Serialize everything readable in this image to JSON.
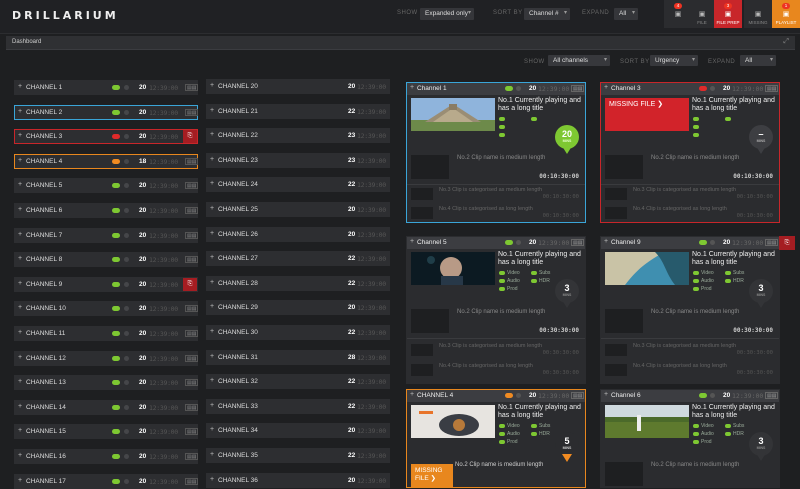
{
  "app": {
    "title": "DRILLARIUM"
  },
  "topbar": {
    "show_label": "SHOW",
    "show_value": "Expanded only",
    "sort_label": "SORT BY",
    "sort_value": "Channel #",
    "expand_label": "EXPAND",
    "expand_value": "All",
    "alerts_title": "ALERTS",
    "alerts": [
      {
        "label": "",
        "count": "4",
        "style": "default"
      },
      {
        "label": "FILE",
        "count": "",
        "style": "default"
      },
      {
        "label": "FILE PREP",
        "count": "3",
        "style": "red"
      },
      {
        "label": "MISSING",
        "count": "",
        "style": "default"
      },
      {
        "label": "PLAYLIST",
        "count": "1",
        "style": "orange"
      }
    ]
  },
  "dashboard": {
    "title": "Dashboard",
    "show_label": "SHOW",
    "show_value": "All channels",
    "sort_label": "SORT BY",
    "sort_value": "Urgency",
    "expand_label": "EXPAND",
    "expand_value": "All"
  },
  "channels_left": [
    {
      "name": "CHANNEL 1",
      "status": "green",
      "count": "20",
      "time": "12:39:00",
      "border": ""
    },
    {
      "name": "CHANNEL 2",
      "status": "green",
      "count": "20",
      "time": "12:39:00",
      "border": "blue"
    },
    {
      "name": "CHANNEL 3",
      "status": "red",
      "count": "20",
      "time": "12:39:00",
      "border": "red",
      "alert": true
    },
    {
      "name": "CHANNEL 4",
      "status": "orange",
      "count": "18",
      "time": "12:39:00",
      "border": "orange"
    },
    {
      "name": "CHANNEL 5",
      "status": "green",
      "count": "20",
      "time": "12:39:00",
      "border": ""
    },
    {
      "name": "CHANNEL 6",
      "status": "green",
      "count": "20",
      "time": "12:39:00",
      "border": ""
    },
    {
      "name": "CHANNEL 7",
      "status": "green",
      "count": "20",
      "time": "12:39:00",
      "border": ""
    },
    {
      "name": "CHANNEL 8",
      "status": "green",
      "count": "20",
      "time": "12:39:00",
      "border": ""
    },
    {
      "name": "CHANNEL 9",
      "status": "green",
      "count": "20",
      "time": "12:39:00",
      "border": "",
      "alert": true
    },
    {
      "name": "CHANNEL 10",
      "status": "green",
      "count": "20",
      "time": "12:39:00",
      "border": ""
    },
    {
      "name": "CHANNEL 11",
      "status": "green",
      "count": "20",
      "time": "12:39:00",
      "border": ""
    },
    {
      "name": "CHANNEL 12",
      "status": "green",
      "count": "20",
      "time": "12:39:00",
      "border": ""
    },
    {
      "name": "CHANNEL 13",
      "status": "green",
      "count": "20",
      "time": "12:39:00",
      "border": ""
    },
    {
      "name": "CHANNEL 14",
      "status": "green",
      "count": "20",
      "time": "12:39:00",
      "border": ""
    },
    {
      "name": "CHANNEL 15",
      "status": "green",
      "count": "20",
      "time": "12:39:00",
      "border": ""
    },
    {
      "name": "CHANNEL 16",
      "status": "green",
      "count": "20",
      "time": "12:39:00",
      "border": ""
    },
    {
      "name": "CHANNEL 17",
      "status": "green",
      "count": "20",
      "time": "12:39:00",
      "border": ""
    }
  ],
  "channels_right": [
    {
      "name": "CHANNEL 20",
      "count": "20",
      "time": "12:39:00"
    },
    {
      "name": "CHANNEL 21",
      "count": "22",
      "time": "12:39:00"
    },
    {
      "name": "CHANNEL 22",
      "count": "23",
      "time": "12:39:00"
    },
    {
      "name": "CHANNEL 23",
      "count": "23",
      "time": "12:39:00"
    },
    {
      "name": "CHANNEL 24",
      "count": "22",
      "time": "12:39:00"
    },
    {
      "name": "CHANNEL 25",
      "count": "20",
      "time": "12:39:00"
    },
    {
      "name": "CHANNEL 26",
      "count": "20",
      "time": "12:39:00"
    },
    {
      "name": "CHANNEL 27",
      "count": "22",
      "time": "12:39:00"
    },
    {
      "name": "CHANNEL 28",
      "count": "22",
      "time": "12:39:00"
    },
    {
      "name": "CHANNEL 29",
      "count": "20",
      "time": "12:39:00"
    },
    {
      "name": "CHANNEL 30",
      "count": "22",
      "time": "12:39:00"
    },
    {
      "name": "CHANNEL 31",
      "count": "28",
      "time": "12:39:00"
    },
    {
      "name": "CHANNEL 32",
      "count": "22",
      "time": "12:39:00"
    },
    {
      "name": "CHANNEL 33",
      "count": "22",
      "time": "12:39:00"
    },
    {
      "name": "CHANNEL 34",
      "count": "20",
      "time": "12:39:00"
    },
    {
      "name": "CHANNEL 35",
      "count": "22",
      "time": "12:39:00"
    },
    {
      "name": "CHANNEL 36",
      "count": "20",
      "time": "12:39:00"
    }
  ],
  "cards": [
    {
      "name": "Channel 1",
      "border": "blue",
      "status": "green",
      "count": "20",
      "time": "12:39:00",
      "now": "No.1 Currently playing and has a long title",
      "pin": "20",
      "pin_unit": "MINS",
      "pin_style": "green",
      "thumb": "pyramid",
      "clip2": "No.2 Clip name is medium length",
      "clip2_time": "00:10:30:00",
      "clip3": "No.3 Clip is categorised as medium length",
      "clip3_time": "00:10:30:00",
      "clip4": "No.4 Clip is categorised as long length",
      "clip4_time": "00:10:30:00",
      "stats": [
        "",
        "",
        "",
        ""
      ]
    },
    {
      "name": "Channel 3",
      "border": "red",
      "status": "red",
      "count": "20",
      "time": "12:39:00",
      "now": "No.1 Currently playing and has a long title",
      "pin": "–",
      "pin_unit": "MINS",
      "pin_style": "dark",
      "thumb": "missing",
      "missing": "MISSING FILE ❯",
      "clip2": "No.2 Clip name is medium length",
      "clip2_time": "00:10:30:00",
      "clip3": "No.3 Clip is categorised as medium length",
      "clip3_time": "00:10:30:00",
      "clip4": "No.4 Clip is categorised as long length",
      "clip4_time": "00:10:30:00",
      "stats": [
        "",
        "",
        "",
        ""
      ]
    },
    {
      "name": "Channel 5",
      "border": "",
      "status": "green",
      "count": "20",
      "time": "12:39:00",
      "now": "No.1 Currently playing and has a long title",
      "pin": "3",
      "pin_unit": "MINS",
      "pin_style": "dark2",
      "thumb": "face",
      "clip2": "No.2 Clip name is medium length",
      "clip2_time": "00:30:30:00",
      "clip3": "No.3 Clip is categorised as medium length",
      "clip3_time": "00:30:30:00",
      "clip4": "No.4 Clip is categorised as long length",
      "clip4_time": "00:30:30:00",
      "stats": [
        "Video",
        "Audio",
        "Prod",
        "Subs",
        "HDR"
      ]
    },
    {
      "name": "Channel 9",
      "border": "",
      "status": "green",
      "count": "20",
      "time": "12:39:00",
      "alert": true,
      "now": "No.1 Currently playing and has a long title",
      "pin": "3",
      "pin_unit": "MINS",
      "pin_style": "dark2",
      "thumb": "coast",
      "clip2": "No.2 Clip name is medium length",
      "clip2_time": "00:30:30:00",
      "clip3": "No.3 Clip is categorised as medium length",
      "clip3_time": "00:30:30:00",
      "clip4": "No.4 Clip is categorised as long length",
      "clip4_time": "00:30:30:00",
      "stats": [
        "Video",
        "Audio",
        "Prod",
        "Subs",
        "HDR"
      ]
    },
    {
      "name": "CHANNEL 4",
      "border": "orange",
      "status": "orange",
      "count": "20",
      "time": "12:39:00",
      "now": "No.1 Currently playing and has a long title",
      "pin": "5",
      "pin_unit": "MINS",
      "pin_style": "orange",
      "thumb": "food",
      "missing": "MISSING FILE ❯",
      "clip2": "No.2 Clip name is medium length",
      "clip2_time": "",
      "stats": [
        "Video",
        "Audio",
        "Prod",
        "Subs",
        "HDR"
      ]
    },
    {
      "name": "Channel 6",
      "border": "",
      "status": "green",
      "count": "20",
      "time": "12:39:00",
      "now": "No.1 Currently playing and has a long title",
      "pin": "3",
      "pin_unit": "MINS",
      "pin_style": "dark2",
      "thumb": "field",
      "clip2": "No.2 Clip name is medium length",
      "clip2_time": "",
      "stats": [
        "Video",
        "Audio",
        "Prod",
        "Subs",
        "HDR"
      ]
    }
  ]
}
